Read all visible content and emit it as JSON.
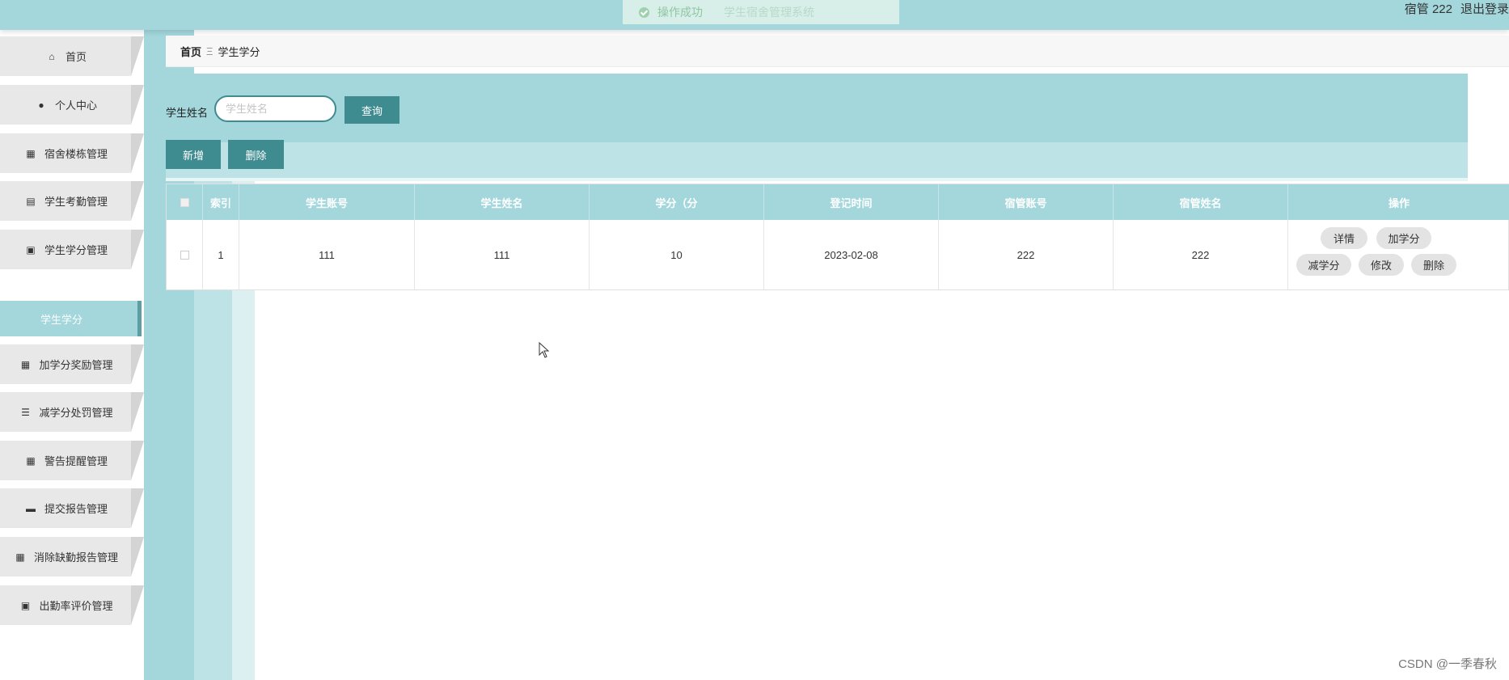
{
  "toast": {
    "icon": "check-circle-icon",
    "message": "操作成功",
    "system_name": "学生宿舍管理系统"
  },
  "user": {
    "label": "宿管 222",
    "logout": "退出登录"
  },
  "sidebar": {
    "items": [
      {
        "label": "首页",
        "icon": "home-icon",
        "glyph": "⌂"
      },
      {
        "label": "个人中心",
        "icon": "user-icon",
        "glyph": "●"
      },
      {
        "label": "宿舍楼栋管理",
        "icon": "grid-icon",
        "glyph": "▦"
      },
      {
        "label": "学生考勤管理",
        "icon": "clipboard-icon",
        "glyph": "▤"
      },
      {
        "label": "学生学分管理",
        "icon": "ticket-icon",
        "glyph": "▣"
      },
      {
        "label": "加学分奖励管理",
        "icon": "grid-icon",
        "glyph": "▦"
      },
      {
        "label": "减学分处罚管理",
        "icon": "list-icon",
        "glyph": "☰"
      },
      {
        "label": "警告提醒管理",
        "icon": "grid-icon",
        "glyph": "▦"
      },
      {
        "label": "提交报告管理",
        "icon": "briefcase-icon",
        "glyph": "▬"
      },
      {
        "label": "消除缺勤报告管理",
        "icon": "grid-icon",
        "glyph": "▦"
      },
      {
        "label": "出勤率评价管理",
        "icon": "clipboard-x-icon",
        "glyph": "▣"
      }
    ],
    "active_sub": "学生学分"
  },
  "breadcrumb": {
    "home": "首页",
    "separator": "Ξ",
    "current": "学生学分"
  },
  "search": {
    "label": "学生姓名",
    "placeholder": "学生姓名",
    "value": "",
    "button": "查询"
  },
  "actions": {
    "add": "新增",
    "delete": "删除"
  },
  "table": {
    "columns": [
      "索引",
      "学生账号",
      "学生姓名",
      "学分（分",
      "登记时间",
      "宿管账号",
      "宿管姓名",
      "操作"
    ],
    "rows": [
      {
        "index": "1",
        "student_account": "111",
        "student_name": "111",
        "credits": "10",
        "date": "2023-02-08",
        "manager_account": "222",
        "manager_name": "222"
      }
    ],
    "row_actions": [
      "详情",
      "加学分",
      "减学分",
      "修改",
      "删除"
    ]
  },
  "watermark": "CSDN @一季春秋"
}
